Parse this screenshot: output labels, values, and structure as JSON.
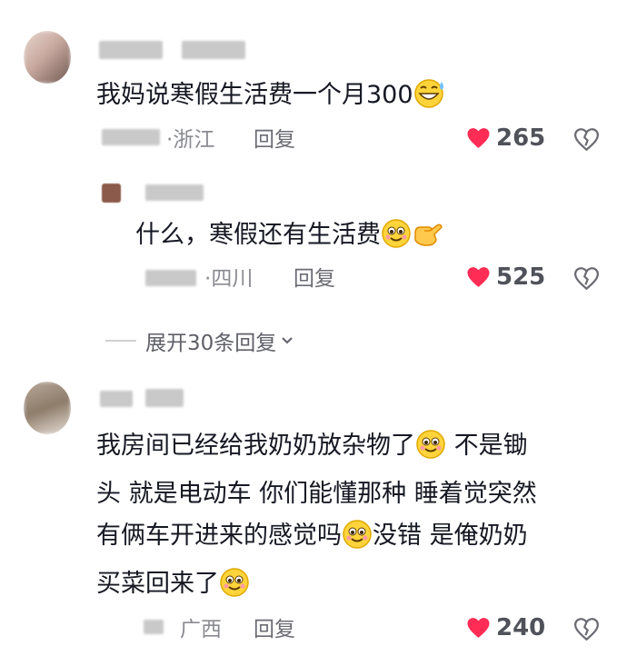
{
  "comments": [
    {
      "text": "我妈说寒假生活费一个月300",
      "emoji": "grinning-sweat-emoji",
      "location_prefix": "·",
      "location": "浙江",
      "reply_label": "回复",
      "likes": "265"
    },
    {
      "text": "什么，寒假还有生活费",
      "emoji": "smiley-emoji",
      "emoji2": "hand-emoji",
      "location_prefix": "·",
      "location": "四川",
      "reply_label": "回复",
      "likes": "525"
    },
    {
      "lines": [
        "我房间已经给我奶奶放杂物了",
        "不是锄",
        "头 就是电动车 你们能懂那种 睡着觉突然",
        "有俩车开进来的感觉吗",
        "没错 是俺奶奶",
        "买菜回来了"
      ],
      "location": "广西",
      "reply_label": "回复",
      "likes": "240"
    }
  ],
  "expand_label": "展开30条回复",
  "colors": {
    "like": "#ff2c55",
    "text": "#161823",
    "meta": "#8a8b91"
  },
  "icons": [
    "heart-icon",
    "dislike-icon",
    "chevron-down-icon"
  ]
}
